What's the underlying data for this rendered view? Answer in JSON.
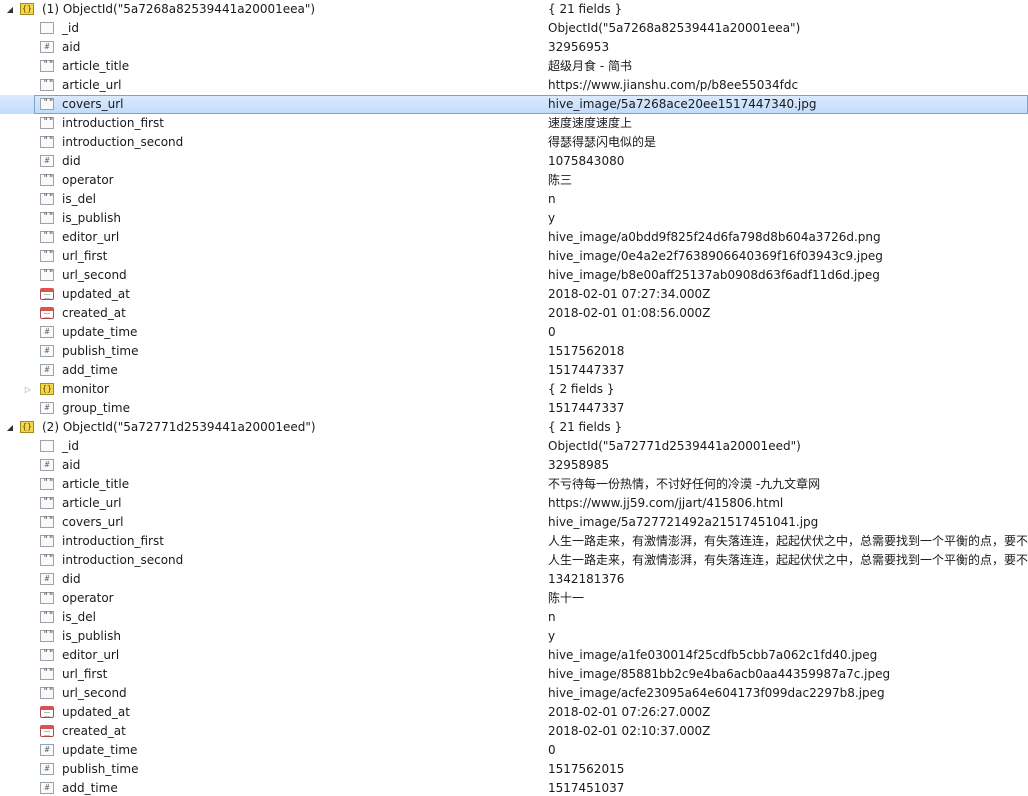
{
  "documents": [
    {
      "header_key": "(1) ObjectId(\"5a7268a82539441a20001eea\")",
      "header_value": "{ 21 fields }",
      "fields": [
        {
          "key": "_id",
          "value": "ObjectId(\"5a7268a82539441a20001eea\")",
          "type": "objectid-icon"
        },
        {
          "key": "aid",
          "value": "32956953",
          "type": "number-icon"
        },
        {
          "key": "article_title",
          "value": "超级月食 - 简书",
          "type": "string-icon"
        },
        {
          "key": "article_url",
          "value": "https://www.jianshu.com/p/b8ee55034fdc",
          "type": "string-icon"
        },
        {
          "key": "covers_url",
          "value": "hive_image/5a7268ace20ee1517447340.jpg",
          "type": "string-icon",
          "selected": true
        },
        {
          "key": "introduction_first",
          "value": "速度速度速度上",
          "type": "string-icon"
        },
        {
          "key": "introduction_second",
          "value": "得瑟得瑟闪电似的是",
          "type": "string-icon"
        },
        {
          "key": "did",
          "value": "1075843080",
          "type": "number-icon"
        },
        {
          "key": "operator",
          "value": "陈三",
          "type": "string-icon"
        },
        {
          "key": "is_del",
          "value": "n",
          "type": "string-icon"
        },
        {
          "key": "is_publish",
          "value": "y",
          "type": "string-icon"
        },
        {
          "key": "editor_url",
          "value": "hive_image/a0bdd9f825f24d6fa798d8b604a3726d.png",
          "type": "string-icon"
        },
        {
          "key": "url_first",
          "value": "hive_image/0e4a2e2f7638906640369f16f03943c9.jpeg",
          "type": "string-icon"
        },
        {
          "key": "url_second",
          "value": "hive_image/b8e00aff25137ab0908d63f6adf11d6d.jpeg",
          "type": "string-icon"
        },
        {
          "key": "updated_at",
          "value": "2018-02-01 07:27:34.000Z",
          "type": "date-icon"
        },
        {
          "key": "created_at",
          "value": "2018-02-01 01:08:56.000Z",
          "type": "date-icon"
        },
        {
          "key": "update_time",
          "value": "0",
          "type": "number-icon"
        },
        {
          "key": "publish_time",
          "value": "1517562018",
          "type": "number-icon"
        },
        {
          "key": "add_time",
          "value": "1517447337",
          "type": "number-icon"
        },
        {
          "key": "monitor",
          "value": "{ 2 fields }",
          "type": "object-icon",
          "collapsed": true
        },
        {
          "key": "group_time",
          "value": "1517447337",
          "type": "number-icon"
        }
      ]
    },
    {
      "header_key": "(2) ObjectId(\"5a72771d2539441a20001eed\")",
      "header_value": "{ 21 fields }",
      "fields": [
        {
          "key": "_id",
          "value": "ObjectId(\"5a72771d2539441a20001eed\")",
          "type": "objectid-icon"
        },
        {
          "key": "aid",
          "value": "32958985",
          "type": "number-icon"
        },
        {
          "key": "article_title",
          "value": "不亏待每一份热情，不讨好任何的冷漠 -九九文章网",
          "type": "string-icon"
        },
        {
          "key": "article_url",
          "value": "https://www.jj59.com/jjart/415806.html",
          "type": "string-icon"
        },
        {
          "key": "covers_url",
          "value": "hive_image/5a727721492a21517451041.jpg",
          "type": "string-icon"
        },
        {
          "key": "introduction_first",
          "value": "人生一路走来，有激情澎湃，有失落连连，起起伏伏之中，总需要找到一个平衡的点，要不",
          "type": "string-icon"
        },
        {
          "key": "introduction_second",
          "value": "人生一路走来，有激情澎湃，有失落连连，起起伏伏之中，总需要找到一个平衡的点，要不",
          "type": "string-icon"
        },
        {
          "key": "did",
          "value": "1342181376",
          "type": "number-icon"
        },
        {
          "key": "operator",
          "value": "陈十一",
          "type": "string-icon"
        },
        {
          "key": "is_del",
          "value": "n",
          "type": "string-icon"
        },
        {
          "key": "is_publish",
          "value": "y",
          "type": "string-icon"
        },
        {
          "key": "editor_url",
          "value": "hive_image/a1fe030014f25cdfb5cbb7a062c1fd40.jpeg",
          "type": "string-icon"
        },
        {
          "key": "url_first",
          "value": "hive_image/85881bb2c9e4ba6acb0aa44359987a7c.jpeg",
          "type": "string-icon"
        },
        {
          "key": "url_second",
          "value": "hive_image/acfe23095a64e604173f099dac2297b8.jpeg",
          "type": "string-icon"
        },
        {
          "key": "updated_at",
          "value": "2018-02-01 07:26:27.000Z",
          "type": "date-icon"
        },
        {
          "key": "created_at",
          "value": "2018-02-01 02:10:37.000Z",
          "type": "date-icon"
        },
        {
          "key": "update_time",
          "value": "0",
          "type": "number-icon"
        },
        {
          "key": "publish_time",
          "value": "1517562015",
          "type": "number-icon"
        },
        {
          "key": "add_time",
          "value": "1517451037",
          "type": "number-icon"
        }
      ]
    }
  ]
}
